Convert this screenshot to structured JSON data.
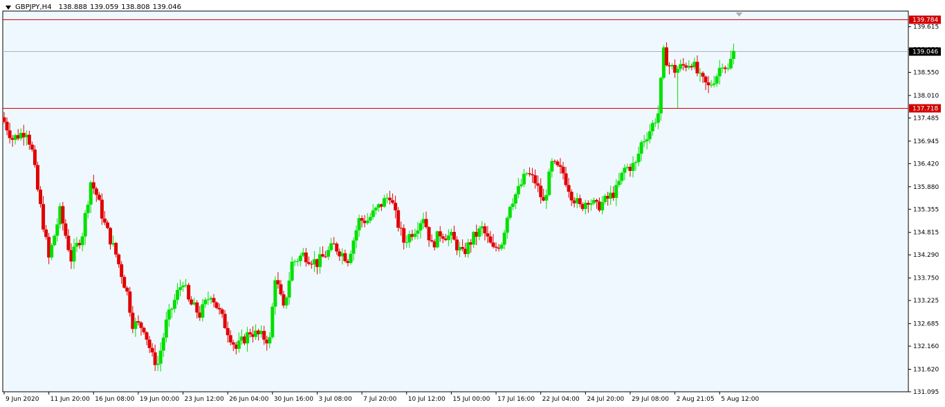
{
  "header": {
    "symbol": "GBPJPY,H4",
    "open": "138.888",
    "high": "139.059",
    "low": "138.808",
    "close": "139.046"
  },
  "colors": {
    "background": "#f0f8ff",
    "bull": "#00e000",
    "bear": "#e00000",
    "hline_red": "#d00000",
    "price_line": "#a8b4c0",
    "price_tag": "#000000"
  },
  "chart_data": {
    "type": "candlestick",
    "y_ticks": [
      "139.615",
      "139.080",
      "138.550",
      "138.010",
      "137.485",
      "136.945",
      "136.420",
      "135.880",
      "135.355",
      "134.815",
      "134.290",
      "133.750",
      "133.225",
      "132.685",
      "132.160",
      "131.620",
      "131.095"
    ],
    "ylim": [
      131.095,
      139.98
    ],
    "x_ticks": [
      {
        "label": "9 Jun 2020",
        "bar": 0
      },
      {
        "label": "11 Jun 20:00",
        "bar": 16
      },
      {
        "label": "16 Jun 08:00",
        "bar": 32
      },
      {
        "label": "19 Jun 00:00",
        "bar": 48
      },
      {
        "label": "23 Jun 12:00",
        "bar": 64
      },
      {
        "label": "26 Jun 04:00",
        "bar": 80
      },
      {
        "label": "30 Jun 16:00",
        "bar": 96
      },
      {
        "label": "3 Jul 08:00",
        "bar": 112
      },
      {
        "label": "7 Jul 20:00",
        "bar": 128
      },
      {
        "label": "10 Jul 12:00",
        "bar": 144
      },
      {
        "label": "15 Jul 00:00",
        "bar": 160
      },
      {
        "label": "17 Jul 16:00",
        "bar": 176
      },
      {
        "label": "22 Jul 04:00",
        "bar": 192
      },
      {
        "label": "24 Jul 20:00",
        "bar": 208
      },
      {
        "label": "29 Jul 08:00",
        "bar": 224
      },
      {
        "label": "2 Aug 21:05",
        "bar": 240
      },
      {
        "label": "5 Aug 12:00",
        "bar": 256
      }
    ],
    "horizontal_lines": [
      {
        "price": 139.784,
        "label": "139.784",
        "color": "#d00000"
      },
      {
        "price": 137.718,
        "label": "137.718",
        "color": "#d00000"
      }
    ],
    "current_price": {
      "price": 139.046,
      "label": "139.046"
    },
    "close_path": [
      [
        0,
        137.4
      ],
      [
        3,
        137.0
      ],
      [
        8,
        137.2
      ],
      [
        10,
        136.7
      ],
      [
        12,
        135.8
      ],
      [
        16,
        134.2
      ],
      [
        20,
        135.3
      ],
      [
        24,
        134.2
      ],
      [
        28,
        134.8
      ],
      [
        31,
        136.0
      ],
      [
        33,
        135.7
      ],
      [
        36,
        135.0
      ],
      [
        40,
        134.3
      ],
      [
        44,
        133.4
      ],
      [
        46,
        132.7
      ],
      [
        50,
        132.6
      ],
      [
        53,
        131.9
      ],
      [
        55,
        131.75
      ],
      [
        58,
        132.7
      ],
      [
        62,
        133.4
      ],
      [
        64,
        133.7
      ],
      [
        66,
        133.2
      ],
      [
        70,
        132.9
      ],
      [
        74,
        133.4
      ],
      [
        78,
        132.8
      ],
      [
        83,
        132.1
      ],
      [
        88,
        132.5
      ],
      [
        95,
        132.3
      ],
      [
        97,
        133.8
      ],
      [
        100,
        133.0
      ],
      [
        103,
        134.1
      ],
      [
        107,
        134.3
      ],
      [
        112,
        134.1
      ],
      [
        118,
        134.5
      ],
      [
        123,
        134.2
      ],
      [
        127,
        135.1
      ],
      [
        130,
        135.1
      ],
      [
        134,
        135.4
      ],
      [
        138,
        135.7
      ],
      [
        140,
        135.2
      ],
      [
        143,
        134.6
      ],
      [
        147,
        134.9
      ],
      [
        150,
        135.2
      ],
      [
        153,
        134.5
      ],
      [
        156,
        134.8
      ],
      [
        160,
        134.7
      ],
      [
        164,
        134.3
      ],
      [
        168,
        134.7
      ],
      [
        171,
        134.9
      ],
      [
        175,
        134.4
      ],
      [
        178,
        134.6
      ],
      [
        181,
        135.5
      ],
      [
        184,
        135.8
      ],
      [
        187,
        136.2
      ],
      [
        190,
        136.0
      ],
      [
        193,
        135.5
      ],
      [
        196,
        136.4
      ],
      [
        200,
        136.2
      ],
      [
        203,
        135.7
      ],
      [
        206,
        135.4
      ],
      [
        209,
        135.6
      ],
      [
        212,
        135.4
      ],
      [
        216,
        135.6
      ],
      [
        219,
        135.8
      ],
      [
        222,
        136.3
      ],
      [
        226,
        136.4
      ],
      [
        228,
        136.9
      ],
      [
        231,
        137.2
      ],
      [
        234,
        137.6
      ],
      [
        236,
        139.0
      ],
      [
        238,
        138.7
      ],
      [
        240,
        138.6
      ],
      [
        243,
        138.7
      ],
      [
        246,
        138.8
      ],
      [
        249,
        138.4
      ],
      [
        252,
        138.2
      ],
      [
        255,
        138.5
      ],
      [
        257,
        138.8
      ],
      [
        259,
        138.6
      ],
      [
        261,
        139.05
      ]
    ]
  }
}
